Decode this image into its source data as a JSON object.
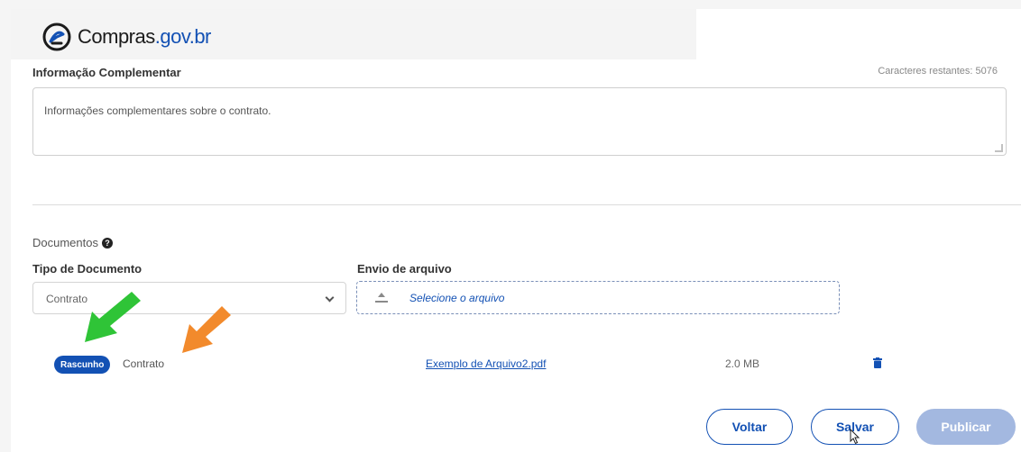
{
  "brand": {
    "name": "Compras",
    "domain": ".gov.br",
    "color": "#1351b4"
  },
  "info": {
    "label": "Informação Complementar",
    "counter": "Caracteres restantes: 5076",
    "value": "Informações complementares sobre o contrato."
  },
  "documents": {
    "title": "Documentos",
    "help_icon": "?",
    "type_label": "Tipo de Documento",
    "type_value": "Contrato",
    "upload_label": "Envio de arquivo",
    "upload_placeholder": "Selecione o arquivo",
    "row": {
      "status": "Rascunho",
      "type": "Contrato",
      "file_name": "Exemplo de Arquivo2.pdf",
      "file_size": "2.0 MB"
    }
  },
  "actions": {
    "back": "Voltar",
    "save": "Salvar",
    "publish": "Publicar"
  },
  "colors": {
    "arrow_green": "#2fc437",
    "arrow_orange": "#f28a2c"
  }
}
